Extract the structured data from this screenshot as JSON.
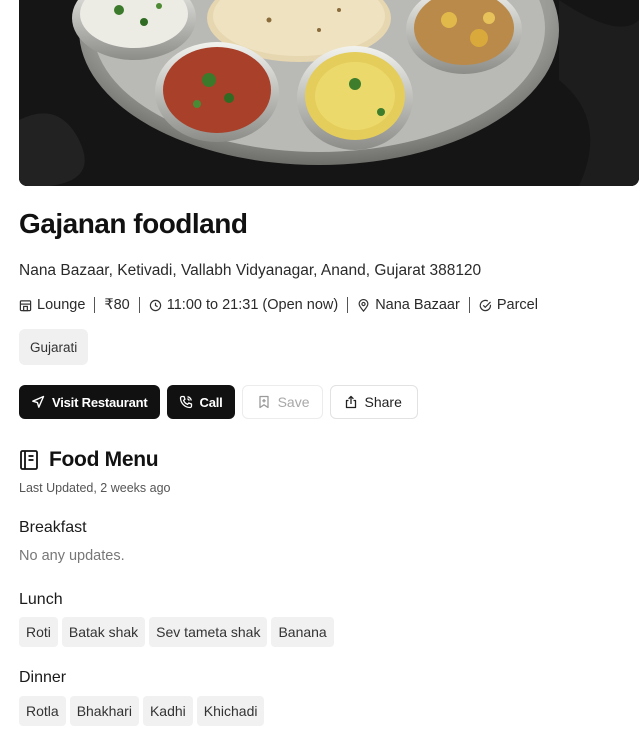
{
  "restaurant": {
    "name": "Gajanan foodland",
    "address": "Nana Bazaar, Ketivadi, Vallabh Vidyanagar, Anand, Gujarat 388120",
    "meta": {
      "type": "Lounge",
      "price": "₹80",
      "hours": "11:00 to 21:31 (Open now)",
      "area": "Nana Bazaar",
      "service": "Parcel"
    },
    "cuisine_tags": [
      "Gujarati"
    ]
  },
  "icons": {
    "type": "store-icon",
    "hours": "clock-icon",
    "area": "map-pin-icon",
    "service": "check-circle-icon",
    "visit": "send-icon",
    "call": "phone-icon",
    "save": "bookmark-icon",
    "share": "share-icon",
    "menu": "menu-book-icon"
  },
  "actions": {
    "visit_label": "Visit Restaurant",
    "call_label": "Call",
    "save_label": "Save",
    "share_label": "Share"
  },
  "menu": {
    "title": "Food Menu",
    "last_updated": "Last Updated, 2 weeks ago",
    "breakfast": {
      "label": "Breakfast",
      "empty_text": "No any updates."
    },
    "lunch": {
      "label": "Lunch",
      "items": [
        "Roti",
        "Batak shak",
        "Sev tameta shak",
        "Banana"
      ]
    },
    "dinner": {
      "label": "Dinner",
      "items": [
        "Rotla",
        "Bhakhari",
        "Kadhi",
        "Khichadi"
      ]
    }
  },
  "colors": {
    "primary_button": "#111111",
    "tag_background": "#f0f0f0",
    "muted_text": "#777777"
  }
}
